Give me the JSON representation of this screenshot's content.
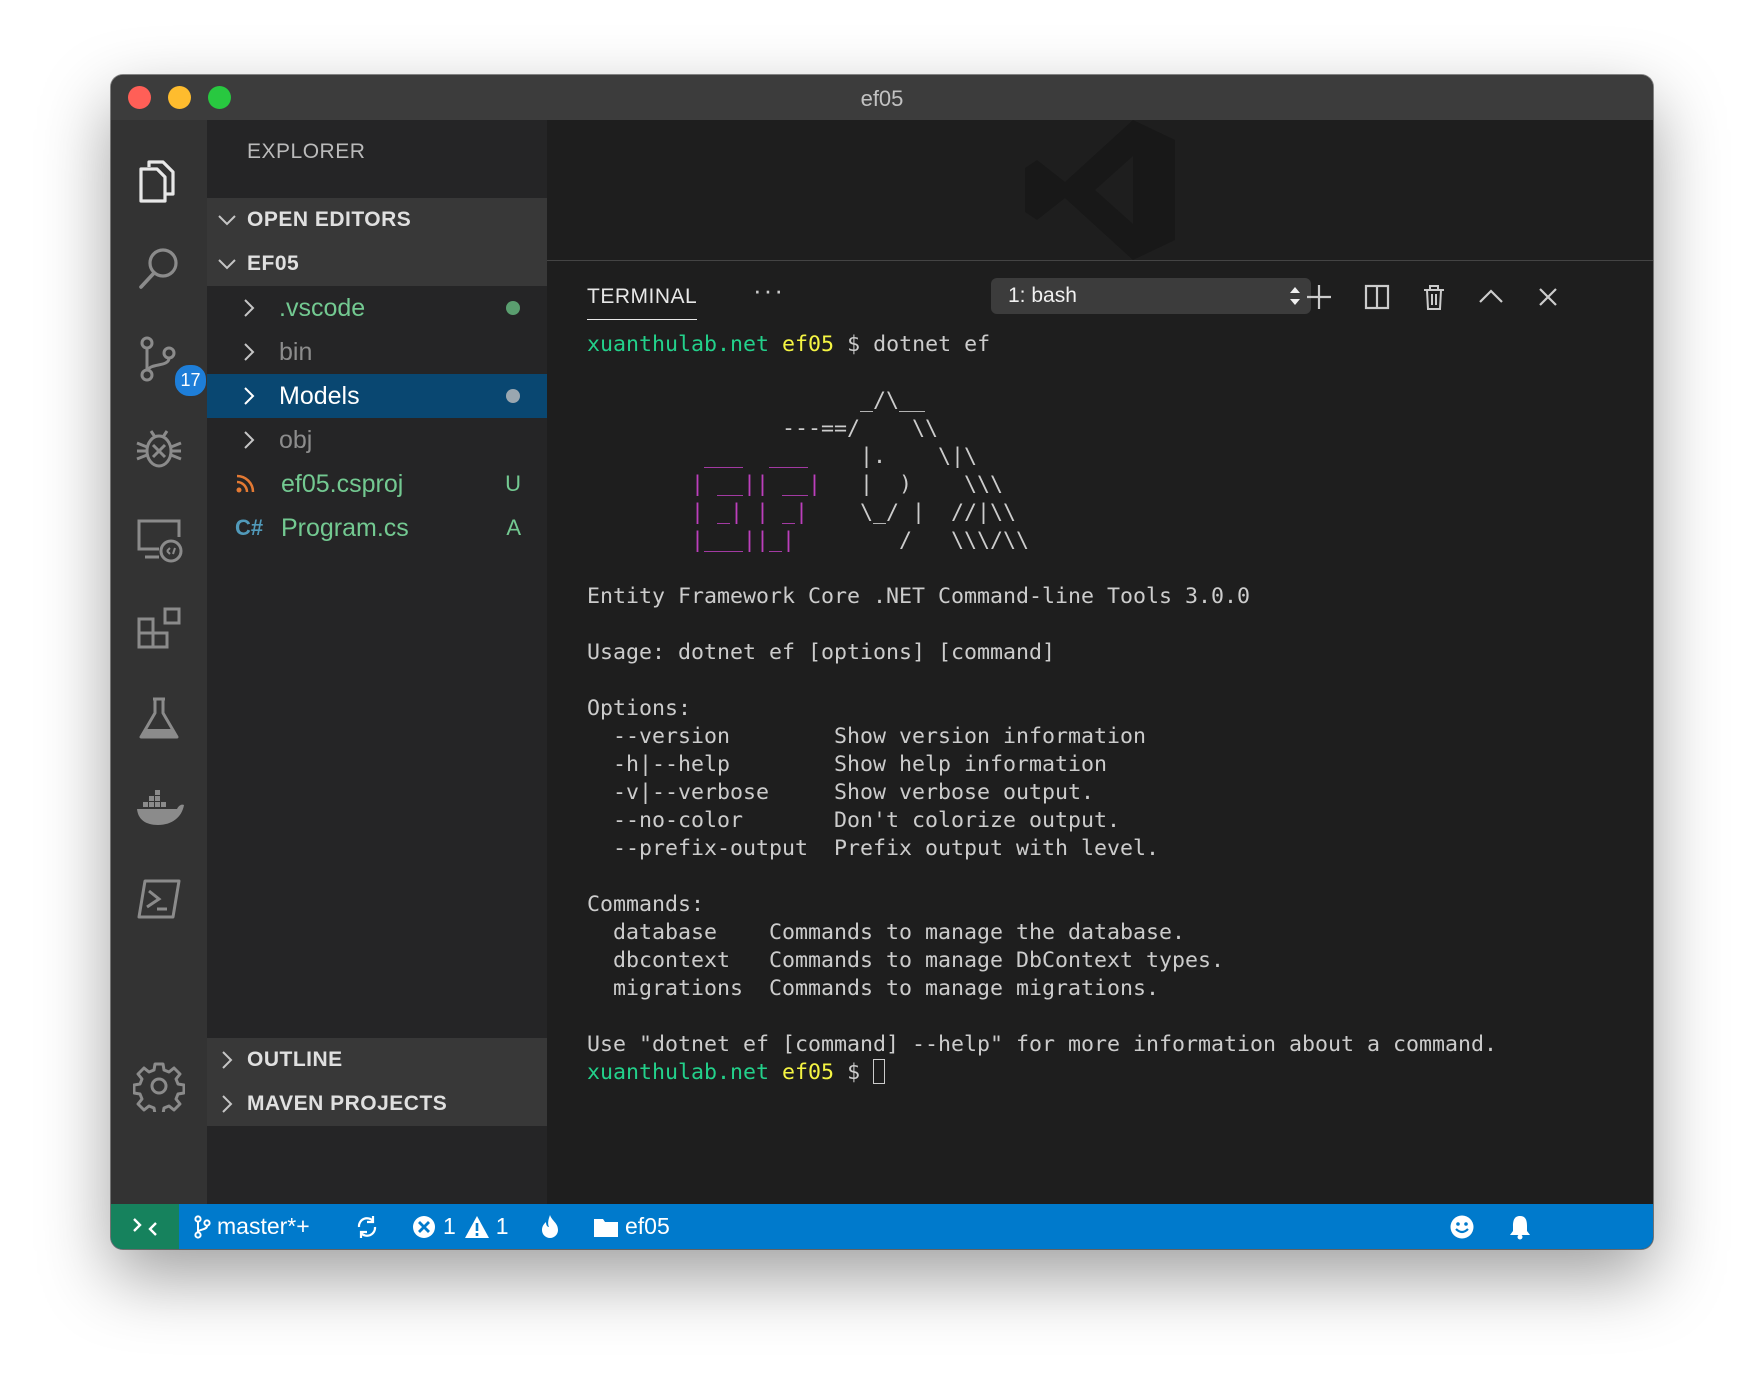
{
  "window": {
    "title": "ef05"
  },
  "activity_bar": {
    "items": [
      "files-icon",
      "search-icon",
      "source-control-icon",
      "debug-icon",
      "remote-explorer-icon",
      "extensions-icon",
      "test-flask-icon",
      "docker-icon",
      "powershell-icon",
      "settings-gear-icon"
    ],
    "source_control_badge": "17"
  },
  "sidebar": {
    "title": "EXPLORER",
    "sections": {
      "open_editors": "OPEN EDITORS",
      "project": "EF05",
      "outline": "OUTLINE",
      "maven": "MAVEN PROJECTS"
    },
    "tree": [
      {
        "name": ".vscode",
        "type": "folder",
        "color": "#73c991",
        "status_dot": "#5a9e6f"
      },
      {
        "name": "bin",
        "type": "folder",
        "color": "#8c8c8c"
      },
      {
        "name": "Models",
        "type": "folder",
        "color": "#ffffff",
        "status_dot": "#9aa7b0",
        "selected": true
      },
      {
        "name": "obj",
        "type": "folder",
        "color": "#8c8c8c"
      },
      {
        "name": "ef05.csproj",
        "type": "rss-file",
        "color": "#73c991",
        "status": "U"
      },
      {
        "name": "Program.cs",
        "type": "csharp-file",
        "color": "#73c991",
        "status": "A",
        "icon_text": "C#"
      }
    ]
  },
  "panel": {
    "tab_label": "TERMINAL",
    "more_label": "···",
    "terminal_select": "1: bash",
    "actions": [
      "add-icon",
      "split-icon",
      "trash-icon",
      "maximize-chevron-icon",
      "close-icon"
    ]
  },
  "terminal": {
    "prompt_host": "xuanthulab.net",
    "prompt_dir": "ef05",
    "prompt_symbol": "$",
    "command": "dotnet ef",
    "logo_lines": [
      [
        "",
        "                     _/\\__"
      ],
      [
        "",
        "               ---==/    \\\\"
      ],
      [
        "         ___  ___    ",
        "|.    \\|\\"
      ],
      [
        "        | __|| __|   ",
        "|  )    \\\\\\"
      ],
      [
        "        | _| | _|    ",
        "\\_/ |  //|\\\\"
      ],
      [
        "        |___||_|     ",
        "   /   \\\\\\/\\\\"
      ]
    ],
    "output_lines": [
      "Entity Framework Core .NET Command-line Tools 3.0.0",
      "",
      "Usage: dotnet ef [options] [command]",
      "",
      "Options:",
      "  --version        Show version information",
      "  -h|--help        Show help information",
      "  -v|--verbose     Show verbose output.",
      "  --no-color       Don't colorize output.",
      "  --prefix-output  Prefix output with level.",
      "",
      "Commands:",
      "  database    Commands to manage the database.",
      "  dbcontext   Commands to manage DbContext types.",
      "  migrations  Commands to manage migrations.",
      "",
      "Use \"dotnet ef [command] --help\" for more information about a command."
    ]
  },
  "status_bar": {
    "branch": "master*+",
    "errors": "1",
    "warnings": "1",
    "folder": "ef05",
    "colors": {
      "background": "#007acc",
      "remote": "#16825d"
    }
  }
}
